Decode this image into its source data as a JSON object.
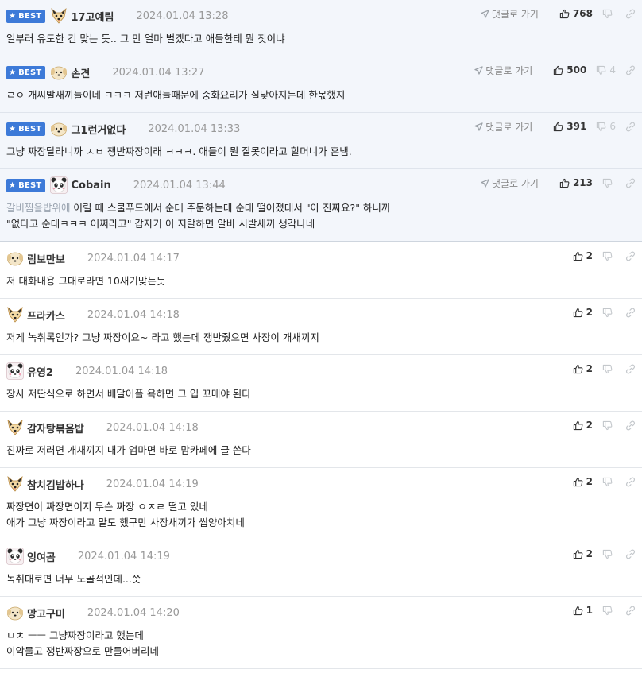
{
  "labels": {
    "best": "BEST",
    "reply": "댓글로 가기"
  },
  "comments": [
    {
      "best": true,
      "avatar": "dog-avatar",
      "nick": "17고예림",
      "date": "2024.01.04 13:28",
      "up": "768",
      "down": "",
      "parent": "",
      "lines": [
        "일부러 유도한 건 맞는 듯.. 그 만 얼마 벌겠다고 애들한테 뭔 짓이냐"
      ]
    },
    {
      "best": true,
      "avatar": "puppy-avatar",
      "nick": "손견",
      "date": "2024.01.04 13:27",
      "up": "500",
      "down": "4",
      "parent": "",
      "lines": [
        "ㄹㅇ 개씨발새끼들이네 ㅋㅋㅋ 저런애들때문에 중화요리가 질낮아지는데 한몫했지"
      ]
    },
    {
      "best": true,
      "avatar": "puppy-avatar",
      "nick": "그1런거없다",
      "date": "2024.01.04 13:33",
      "up": "391",
      "down": "6",
      "parent": "",
      "lines": [
        "그냥 짜장달라니까 ㅅㅂ 쟁반짜장이래 ㅋㅋㅋ. 애들이 뭔 잘못이라고 할머니가 혼냄."
      ]
    },
    {
      "best": true,
      "avatar": "panda-avatar",
      "nick": "Cobain",
      "date": "2024.01.04 13:44",
      "up": "213",
      "down": "",
      "parent": "갈비찜을밥위에",
      "lines": [
        "어릴 때 스쿨푸드에서 순대 주문하는데 순대 떨어졌대서 \"아 진짜요?\" 하니까",
        "\"없다고 순대ㅋㅋㅋ 어쩌라고\" 갑자기 이 지랄하면 알바 시발새끼 생각나네"
      ]
    },
    {
      "best": false,
      "avatar": "puppy-avatar",
      "nick": "림보만보",
      "date": "2024.01.04 14:17",
      "up": "2",
      "down": "",
      "parent": "",
      "lines": [
        "저 대화내용 그대로라면 10새기맞는듯"
      ]
    },
    {
      "best": false,
      "avatar": "dog-avatar",
      "nick": "프라카스",
      "date": "2024.01.04 14:18",
      "up": "2",
      "down": "",
      "parent": "",
      "lines": [
        "저게 녹취록인가? 그냥 짜장이요~ 라고 했는데 쟁반줬으면 사장이 개새끼지"
      ]
    },
    {
      "best": false,
      "avatar": "panda-avatar",
      "nick": "유영2",
      "date": "2024.01.04 14:18",
      "up": "2",
      "down": "",
      "parent": "",
      "lines": [
        "장사 저딴식으로 하면서 배달어플 욕하면 그 입 꼬매야 된다"
      ]
    },
    {
      "best": false,
      "avatar": "dog-avatar",
      "nick": "감자탕볶음밥",
      "date": "2024.01.04 14:18",
      "up": "2",
      "down": "",
      "parent": "",
      "lines": [
        "진짜로 저러면 개새끼지 내가 엄마면 바로 맘카페에 글 쓴다"
      ]
    },
    {
      "best": false,
      "avatar": "dog-avatar",
      "nick": "참치김밥하나",
      "date": "2024.01.04 14:19",
      "up": "2",
      "down": "",
      "parent": "",
      "lines": [
        "짜장면이 짜장면이지 무슨 짜장 ㅇㅈㄹ 떨고 있네",
        "애가 그냥 짜장이라고 말도 했구만 사장새끼가 씹양아치네"
      ]
    },
    {
      "best": false,
      "avatar": "panda-avatar",
      "nick": "잉여곰",
      "date": "2024.01.04 14:19",
      "up": "2",
      "down": "",
      "parent": "",
      "lines": [
        "녹취대로면 너무 노골적인데...쯧"
      ]
    },
    {
      "best": false,
      "avatar": "puppy-avatar",
      "nick": "망고구미",
      "date": "2024.01.04 14:20",
      "up": "1",
      "down": "",
      "parent": "",
      "lines": [
        "ㅁㅊ ㅡㅡ 그냥짜장이라고 했는데",
        "이악물고 쟁반짜장으로 만들어버리네"
      ]
    }
  ]
}
